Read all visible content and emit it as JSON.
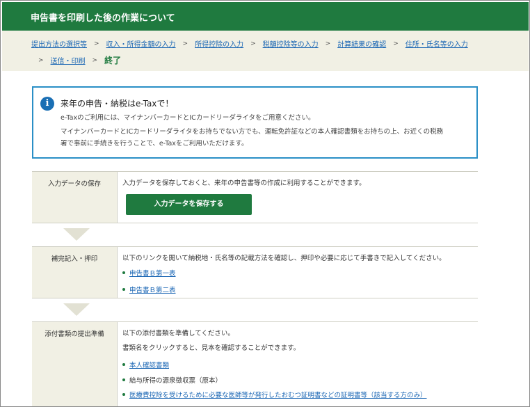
{
  "header": {
    "title": "申告書を印刷した後の作業について"
  },
  "breadcrumb": {
    "items": [
      "提出方法の選択等",
      "収入・所得金額の入力",
      "所得控除の入力",
      "税額控除等の入力",
      "計算結果の確認",
      "住所・氏名等の入力",
      "送信・印刷"
    ],
    "separator": ">",
    "current": "終了"
  },
  "notice": {
    "icon": "info-icon",
    "title": "来年の申告・納税はe-Taxで！",
    "line1": "e-Taxのご利用には、マイナンバーカードとICカードリーダライタをご用意ください。",
    "line2": "マイナンバーカードとICカードリーダライタをお持ちでない方でも、運転免許証などの本人確認書類をお持ちの上、お近くの税務",
    "line3": "署で事前に手続きを行うことで、e-Taxをご利用いただけます。"
  },
  "steps": {
    "save": {
      "label": "入力データの保存",
      "text": "入力データを保存しておくと、来年の申告書等の作成に利用することができます。",
      "button": "入力データを保存する"
    },
    "fill": {
      "label": "補完記入・押印",
      "text": "以下のリンクを開いて納税地・氏名等の記載方法を確認し、押印や必要に応じて手書きで記入してください。",
      "links": [
        "申告書Ｂ第一表",
        "申告書Ｂ第二表"
      ]
    },
    "attach": {
      "label": "添付書類の提出準備",
      "text1": "以下の添付書類を準備してください。",
      "text2": "書類名をクリックすると、見本を確認することができます。",
      "items": [
        {
          "text": "本人確認書類",
          "link": true
        },
        {
          "text": "給与所得の源泉徴収票（原本）",
          "link": false
        },
        {
          "text": "医療費控除を受けるために必要な医師等が発行したおむつ証明書などの証明書等（該当する方のみ）",
          "link": true
        }
      ]
    }
  }
}
